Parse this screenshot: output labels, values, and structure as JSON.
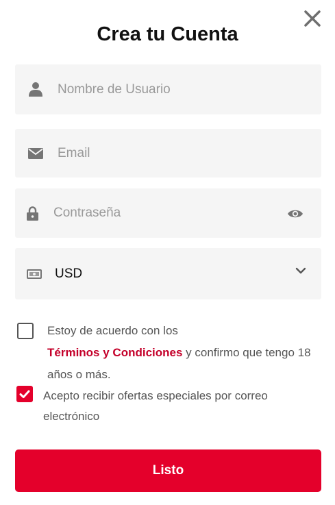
{
  "title": "Crea tu Cuenta",
  "close": {
    "icon": "close-icon"
  },
  "username": {
    "placeholder": "Nombre de Usuario",
    "value": "",
    "icon": "user-icon"
  },
  "email": {
    "placeholder": "Email",
    "value": "",
    "icon": "envelope-icon"
  },
  "password": {
    "placeholder": "Contraseña",
    "value": "",
    "icon": "lock-icon",
    "toggle_icon": "eye-icon"
  },
  "currency": {
    "selected": "USD",
    "icon": "banknote-icon",
    "dropdown_icon": "chevron-down-icon"
  },
  "terms": {
    "checked": false,
    "text_before": "Estoy de acuerdo con los",
    "link": "Términos y Condiciones",
    "text_after": " y confirmo que tengo 18",
    "text_line3": "años o más."
  },
  "offers": {
    "checked": true,
    "line1": "Acepto recibir ofertas especiales por correo",
    "line2": "electrónico"
  },
  "submit": {
    "label": "Listo"
  },
  "colors": {
    "accent": "#e4002b",
    "link": "#c4002a",
    "field_bg": "#f5f5f5"
  }
}
